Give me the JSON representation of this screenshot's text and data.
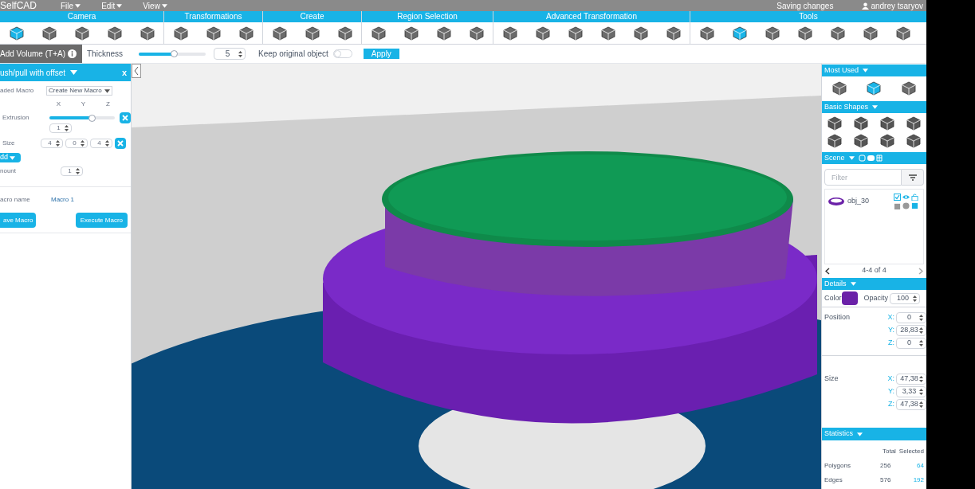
{
  "app": {
    "logo": "SelfCAD",
    "menus": [
      "File",
      "Edit",
      "View"
    ],
    "status": "Saving changes",
    "user": "andrey tsaryov"
  },
  "toolbar": [
    {
      "label": "Camera",
      "tools": [
        {
          "selected": true
        },
        {
          "selected": false
        },
        {
          "selected": false
        },
        {
          "selected": false
        },
        {
          "selected": false
        }
      ]
    },
    {
      "label": "Transformations",
      "tools": [
        {
          "selected": false
        },
        {
          "selected": false
        },
        {
          "selected": false
        }
      ]
    },
    {
      "label": "Create",
      "tools": [
        {
          "selected": false
        },
        {
          "selected": false
        },
        {
          "selected": false
        }
      ]
    },
    {
      "label": "Region Selection",
      "tools": [
        {
          "selected": false
        },
        {
          "selected": false
        },
        {
          "selected": false
        },
        {
          "selected": false
        }
      ]
    },
    {
      "label": "Advanced Transformation",
      "tools": [
        {
          "selected": false
        },
        {
          "selected": false
        },
        {
          "selected": false
        },
        {
          "selected": false
        },
        {
          "selected": false
        },
        {
          "selected": false
        }
      ]
    },
    {
      "label": "Tools",
      "tools": [
        {
          "selected": false
        },
        {
          "selected": true
        },
        {
          "selected": false
        },
        {
          "selected": false
        },
        {
          "selected": false
        },
        {
          "selected": false
        },
        {
          "selected": false
        }
      ]
    }
  ],
  "options_bar": {
    "tool": "Add Volume (T+A)",
    "thickness_label": "Thickness",
    "thickness": {
      "level": 0.53,
      "value": "5"
    },
    "keep_label": "Keep original object",
    "keep_original": false,
    "apply": "Apply"
  },
  "macro_panel": {
    "title": "ush/pull with offset",
    "close": "x",
    "loaded_label": "aded Macro",
    "loaded_value": "Create New Macro",
    "axes": [
      "X",
      "Y",
      "Z"
    ],
    "extrusion": {
      "label": "Extrusion",
      "level": 0.65,
      "value": "1"
    },
    "size": {
      "label": "Size",
      "values": [
        "4",
        "0",
        "4"
      ]
    },
    "add": "dd",
    "amount": {
      "label": "nount",
      "value": "1"
    },
    "macro_name": {
      "label": "acro name",
      "value": "Macro 1"
    },
    "buttons": [
      "ave Macro",
      "Execute Macro"
    ]
  },
  "right_panel": {
    "most_used": {
      "title": "Most Used",
      "items": [
        {
          "selected": false
        },
        {
          "selected": true
        },
        {
          "selected": false
        }
      ]
    },
    "basic_shapes": {
      "title": "Basic Shapes"
    },
    "scene": {
      "title": "Scene",
      "filter_placeholder": "Filter",
      "objects": [
        {
          "name": "obj_30",
          "visible_checked": true
        }
      ],
      "pager": "4-4 of 4"
    },
    "details": {
      "title": "Details",
      "color_label": "Color",
      "color": "#6b21a8",
      "opacity_label": "Opacity",
      "opacity": "100",
      "position": {
        "label": "Position",
        "fields": [
          {
            "axis": "X:",
            "value": "0"
          },
          {
            "axis": "Y:",
            "value": "28,83"
          },
          {
            "axis": "Z:",
            "value": "0"
          }
        ]
      },
      "size": {
        "label": "Size",
        "fields": [
          {
            "axis": "X:",
            "value": "47,38"
          },
          {
            "axis": "Y:",
            "value": "3,33"
          },
          {
            "axis": "Z:",
            "value": "47,38"
          }
        ]
      }
    },
    "statistics": {
      "title": "Statistics",
      "columns": [
        "Total",
        "Selected"
      ],
      "rows": [
        {
          "label": "Polygons",
          "total": "256",
          "selected": "64"
        },
        {
          "label": "Edges",
          "total": "576",
          "selected": "192"
        }
      ]
    }
  }
}
